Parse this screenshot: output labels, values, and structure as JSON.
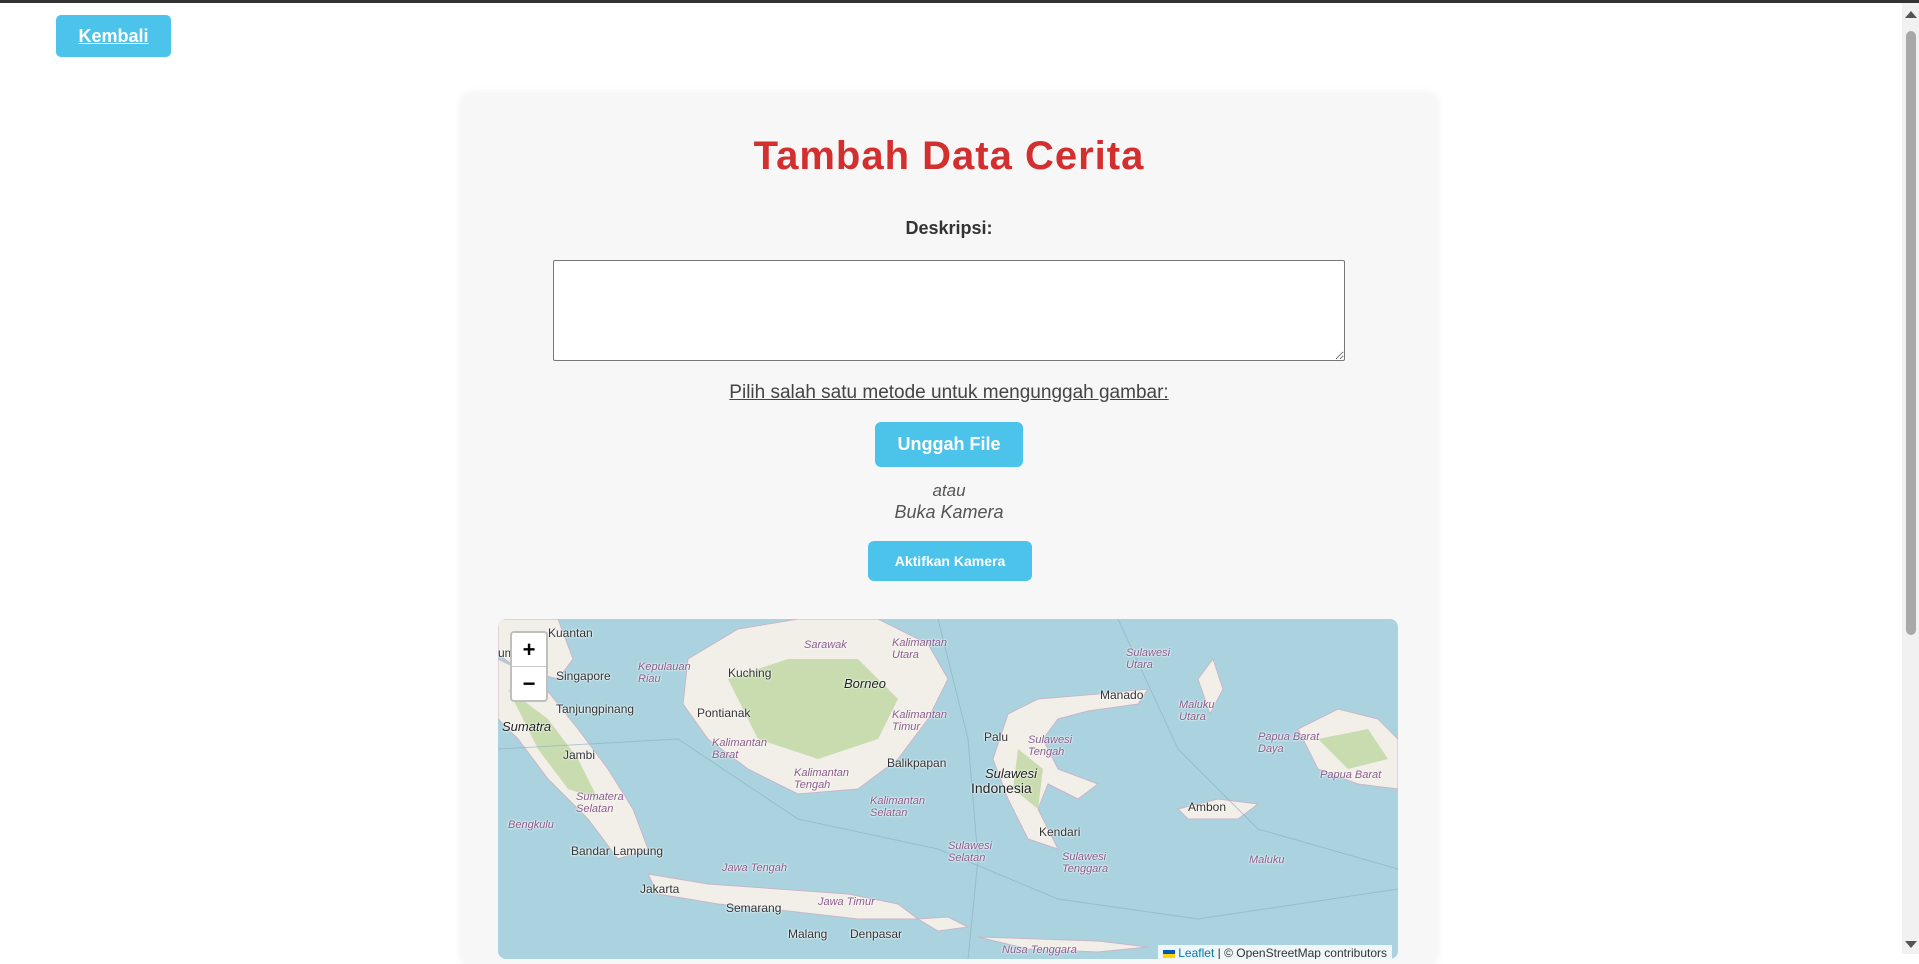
{
  "nav": {
    "back_label": "Kembali"
  },
  "form": {
    "title": "Tambah Data Cerita",
    "description_label": "Deskripsi:",
    "description_value": "",
    "method_prompt": "Pilih salah satu metode untuk mengunggah gambar:",
    "upload_button": "Unggah File",
    "or_text": "atau",
    "camera_heading": "Buka Kamera",
    "camera_button": "Aktifkan Kamera"
  },
  "map": {
    "zoom_in": "+",
    "zoom_out": "−",
    "attribution_link": "Leaflet",
    "attribution_text": "| © OpenStreetMap contributors",
    "labels": {
      "kuantan": "Kuantan",
      "lumpur": "umpur",
      "singapore": "Singapore",
      "kepulauan_riau": "Kepulauan Riau",
      "tanjungpinang": "Tanjungpinang",
      "sumatra": "Sumatra",
      "jambi": "Jambi",
      "sumatera_selatan": "Sumatera Selatan",
      "bengkulu": "Bengkulu",
      "bandar_lampung": "Bandar Lampung",
      "jakarta": "Jakarta",
      "semarang": "Semarang",
      "jawa_tengah": "Jawa Tengah",
      "jawa_timur": "Jawa Timur",
      "malang": "Malang",
      "denpasar": "Denpasar",
      "kuching": "Kuching",
      "sarawak": "Sarawak",
      "borneo": "Borneo",
      "pontianak": "Pontianak",
      "kalimantan_barat": "Kalimantan Barat",
      "kalimantan_tengah": "Kalimantan Tengah",
      "kalimantan_utara": "Kalimantan Utara",
      "kalimantan_timur": "Kalimantan Timur",
      "kalimantan_selatan": "Kalimantan Selatan",
      "balikpapan": "Balikpapan",
      "palu": "Palu",
      "sulawesi": "Sulawesi",
      "indonesia": "Indonesia",
      "sulawesi_tengah": "Sulawesi Tengah",
      "sulawesi_utara": "Sulawesi Utara",
      "manado": "Manado",
      "kendari": "Kendari",
      "sulawesi_selatan": "Sulawesi Selatan",
      "sulawesi_tenggara": "Sulawesi Tenggara",
      "maluku_utara": "Maluku Utara",
      "ambon": "Ambon",
      "maluku": "Maluku",
      "papua_barat_daya": "Papua Barat Daya",
      "papua_barat": "Papua Barat",
      "nusa_tenggara": "Nusa Tenggara"
    }
  },
  "colors": {
    "accent": "#4cc3ea",
    "title": "#d32f2f",
    "sea": "#aad3df",
    "land": "#f2efe9",
    "forest": "#c8dcb0"
  }
}
